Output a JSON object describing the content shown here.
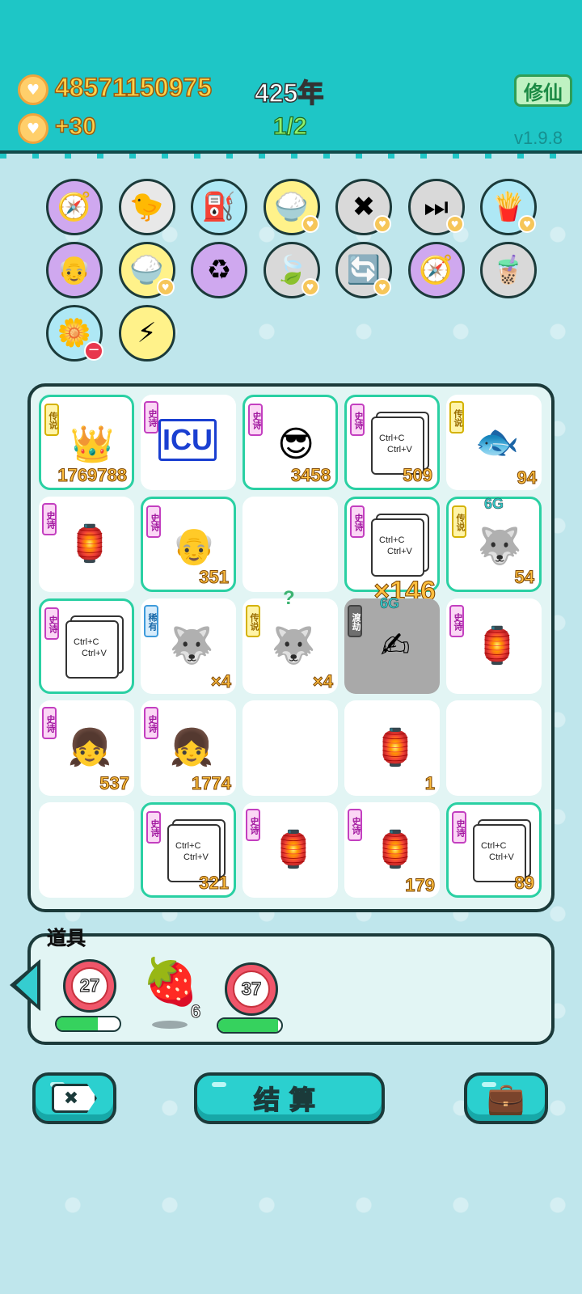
{
  "header": {
    "coins": "48571150975",
    "coin_rate": "+30",
    "year": "425年",
    "page": "1/2",
    "mode_button": "修仙",
    "version": "v1.9.8"
  },
  "icons_row": [
    {
      "name": "compass-icon",
      "glyph": "🧭",
      "bg": "#cfa8ef",
      "heart": false
    },
    {
      "name": "pot-duck-icon",
      "glyph": "🐤",
      "bg": "#e8e8e8",
      "heart": false
    },
    {
      "name": "pump-icon",
      "glyph": "⛽",
      "bg": "#aee8f5",
      "heart": false
    },
    {
      "name": "rice-bowl-icon",
      "glyph": "🍚",
      "bg": "#fff28a",
      "heart": true
    },
    {
      "name": "delete-icon",
      "glyph": "✖",
      "bg": "#d9d9d9",
      "heart": true
    },
    {
      "name": "skip-icon",
      "glyph": "⏭",
      "bg": "#d9d9d9",
      "heart": true
    },
    {
      "name": "fries-icon",
      "glyph": "🍟",
      "bg": "#aee8f5",
      "heart": true
    },
    {
      "name": "math-grandpa-icon",
      "glyph": "👴",
      "bg": "#cfa8ef",
      "heart": false
    },
    {
      "name": "rice-bowl-icon",
      "glyph": "🍚",
      "bg": "#fff28a",
      "heart": true
    },
    {
      "name": "recycle-icon",
      "glyph": "♻",
      "bg": "#cfa8ef",
      "heart": false
    },
    {
      "name": "leaf-icon",
      "glyph": "🍃",
      "bg": "#d9d9d9",
      "heart": true
    },
    {
      "name": "refresh-icon",
      "glyph": "🔄",
      "bg": "#d9d9d9",
      "heart": true
    },
    {
      "name": "compass-icon",
      "glyph": "🧭",
      "bg": "#cfa8ef",
      "heart": false
    },
    {
      "name": "bubble-tea-icon",
      "glyph": "🧋",
      "bg": "#d9d9d9",
      "heart": false
    },
    {
      "name": "flower-pot-icon",
      "glyph": "🌼",
      "bg": "#aee8f5",
      "minus": true
    },
    {
      "name": "lightning-icon",
      "glyph": "⚡",
      "bg": "#fff28a",
      "heart": false
    }
  ],
  "board": {
    "cells": [
      {
        "tag": "传说",
        "tagtype": "legend",
        "hl": true,
        "pic": "👑",
        "count": "1769788"
      },
      {
        "tag": "史诗",
        "tagtype": "epic",
        "icu": "ICU",
        "count": ""
      },
      {
        "tag": "史诗",
        "tagtype": "epic",
        "hl": true,
        "pic": "😎",
        "count": "3458"
      },
      {
        "tag": "史诗",
        "tagtype": "epic",
        "hl": true,
        "ctrl": true,
        "count": "509"
      },
      {
        "tag": "传说",
        "tagtype": "legend",
        "pic": "🐟",
        "count": "94"
      },
      {
        "tag": "史诗",
        "tagtype": "epic",
        "pic": "🏮",
        "count": ""
      },
      {
        "tag": "史诗",
        "tagtype": "epic",
        "hl": true,
        "pic": "👴",
        "count": "351"
      },
      {
        "empty": true
      },
      {
        "tag": "史诗",
        "tagtype": "epic",
        "hl": true,
        "ctrl": true,
        "count": "",
        "overlay": "×146"
      },
      {
        "tag": "传说",
        "tagtype": "legend",
        "hl": true,
        "pic": "🐺",
        "count": "54",
        "g": "6G"
      },
      {
        "tag": "史诗",
        "tagtype": "epic",
        "hl": true,
        "ctrl": true,
        "count": ""
      },
      {
        "tag": "稀有",
        "tagtype": "rare",
        "pic": "🐺",
        "count": "×4"
      },
      {
        "tag": "传说",
        "tagtype": "legend",
        "pic": "🐺",
        "count": "×4",
        "q": "?"
      },
      {
        "tag": "渡劫",
        "tagtype": "grey",
        "grey": true,
        "pic": "✍",
        "count": "",
        "g": "6G"
      },
      {
        "tag": "史诗",
        "tagtype": "epic",
        "pic": "🏮",
        "count": ""
      },
      {
        "tag": "史诗",
        "tagtype": "epic",
        "pic": "👧",
        "count": "537"
      },
      {
        "tag": "史诗",
        "tagtype": "epic",
        "pic": "👧",
        "count": "1774"
      },
      {
        "empty": true
      },
      {
        "tag": "",
        "tagtype": "epic",
        "pic": "🏮",
        "count": "1"
      },
      {
        "empty": true
      },
      {
        "empty": true
      },
      {
        "tag": "史诗",
        "tagtype": "epic",
        "hl": true,
        "ctrl": true,
        "count": "321"
      },
      {
        "tag": "史诗",
        "tagtype": "epic",
        "pic": "🏮",
        "count": ""
      },
      {
        "tag": "史诗",
        "tagtype": "epic",
        "pic": "🏮",
        "count": "179"
      },
      {
        "tag": "史诗",
        "tagtype": "epic",
        "hl": true,
        "ctrl": true,
        "count": "89"
      }
    ],
    "ctrl_c": "Ctrl+C",
    "ctrl_v": "Ctrl+V"
  },
  "props": {
    "title": "道具",
    "items": [
      {
        "type": "timer",
        "value": "27",
        "progress": 0.65
      },
      {
        "type": "strawberry",
        "value": "6"
      },
      {
        "type": "timer",
        "value": "37",
        "progress": 0.95
      }
    ]
  },
  "bottom": {
    "settle_label": "结算"
  }
}
